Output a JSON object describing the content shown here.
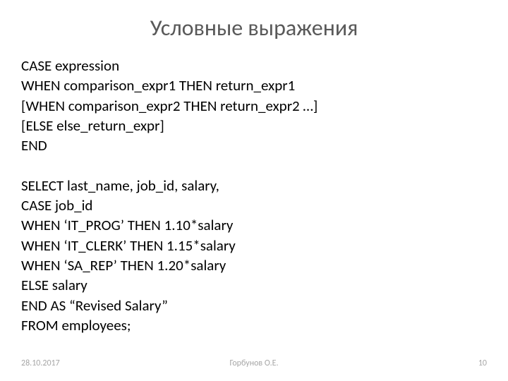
{
  "title": "Условные выражения",
  "syntax": {
    "line1": "CASE expression",
    "line2": "WHEN comparison_expr1 THEN return_expr1",
    "line3": "[WHEN comparison_expr2 THEN return_expr2 …]",
    "line4": "[ELSE else_return_expr]",
    "line5": "END"
  },
  "example": {
    "line1": "SELECT last_name, job_id, salary,",
    "line2": "CASE job_id",
    "line3": "WHEN ‘IT_PROG’ THEN 1.10*salary",
    "line4": "WHEN ‘IT_CLERK’ THEN 1.15*salary",
    "line5": "WHEN ‘SA_REP’ THEN 1.20*salary",
    "line6": "ELSE salary",
    "line7": "END AS “Revised Salary”",
    "line8": "FROM employees;"
  },
  "footer": {
    "date": "28.10.2017",
    "author": "Горбунов О.Е.",
    "page": "10"
  }
}
